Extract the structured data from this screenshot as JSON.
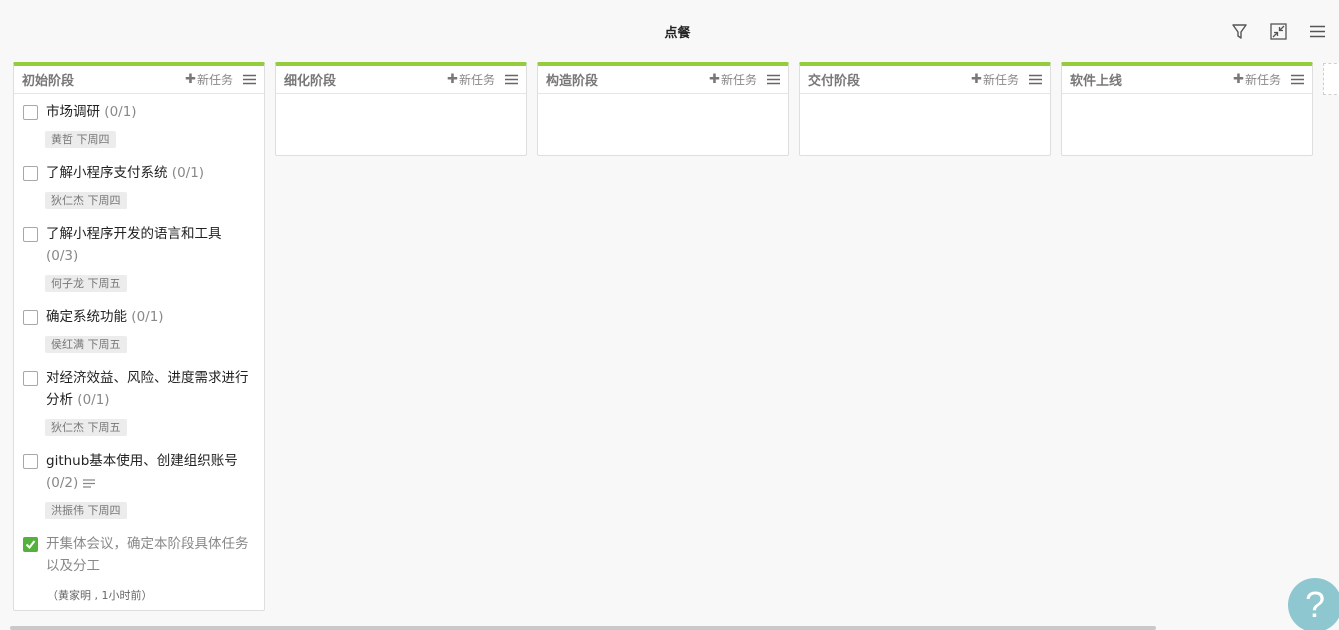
{
  "header": {
    "title": "点餐",
    "icons": [
      "filter-icon",
      "collapse-icon",
      "menu-icon"
    ]
  },
  "add_task_label": "新任务",
  "columns": [
    {
      "title": "初始阶段",
      "tasks": [
        {
          "text": "市场调研",
          "count": "(0/1)",
          "tag": "黄哲 下周四",
          "done": false
        },
        {
          "text": "了解小程序支付系统",
          "count": "(0/1)",
          "tag": "狄仁杰 下周四",
          "done": false
        },
        {
          "text": "了解小程序开发的语言和工具",
          "count": "(0/3)",
          "tag": "何子龙 下周五",
          "done": false
        },
        {
          "text": "确定系统功能",
          "count": "(0/1)",
          "tag": "侯红满 下周五",
          "done": false
        },
        {
          "text": "对经济效益、风险、进度需求进行分析",
          "count": "(0/1)",
          "tag": "狄仁杰 下周五",
          "done": false
        },
        {
          "text": "github基本使用、创建组织账号",
          "count": "(0/2)",
          "tag": "洪振伟 下周四",
          "done": false,
          "has_note": true
        },
        {
          "text": "开集体会议，确定本阶段具体任务以及分工",
          "meta": "（黄家明 , 1小时前）",
          "done": true
        }
      ]
    },
    {
      "title": "细化阶段",
      "tasks": []
    },
    {
      "title": "构造阶段",
      "tasks": []
    },
    {
      "title": "交付阶段",
      "tasks": []
    },
    {
      "title": "软件上线",
      "tasks": []
    }
  ],
  "peek_column_text": "添",
  "help_label": "?",
  "colors": {
    "accent": "#95cc3e",
    "check": "#55b13d",
    "help": "#8ec7cf"
  }
}
